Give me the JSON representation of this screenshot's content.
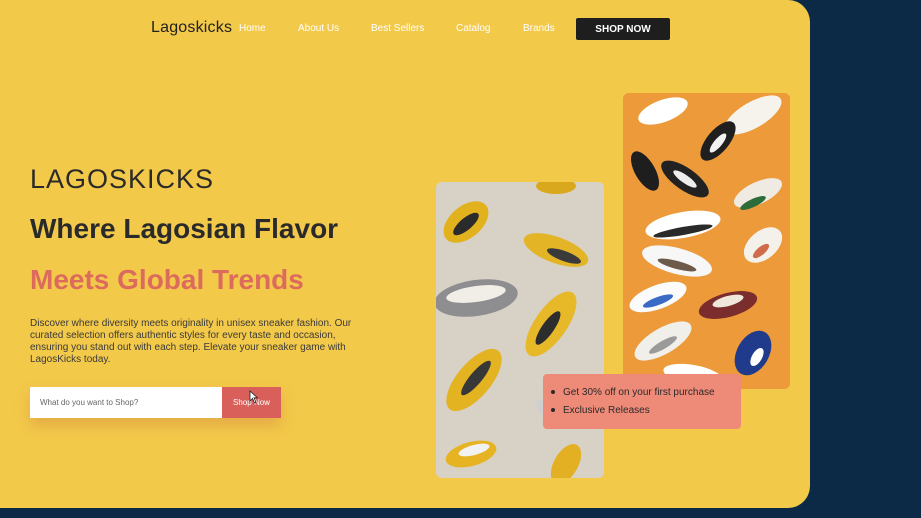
{
  "nav": {
    "logo": "Lagoskicks",
    "links": [
      "Home",
      "About Us",
      "Best Sellers",
      "Catalog",
      "Brands"
    ],
    "cta": "SHOP NOW"
  },
  "hero": {
    "brand": "LAGOSKICKS",
    "headline": "Where Lagosian Flavor",
    "subheadline": "Meets Global Trends",
    "description": "Discover where diversity meets originality in unisex sneaker fashion. Our curated selection offers authentic styles for every taste and occasion, ensuring you stand out with each step. Elevate your sneaker game with LagosKicks today.",
    "search_placeholder": "What do you want to Shop?",
    "search_button": "Shop Now"
  },
  "promo": {
    "items": [
      "Get 30% off on your first purchase",
      "Exclusive Releases"
    ]
  },
  "colors": {
    "background": "#f3c94a",
    "accent": "#dc6b5e",
    "dark": "#1e1e1e",
    "outer": "#0c2a45"
  }
}
